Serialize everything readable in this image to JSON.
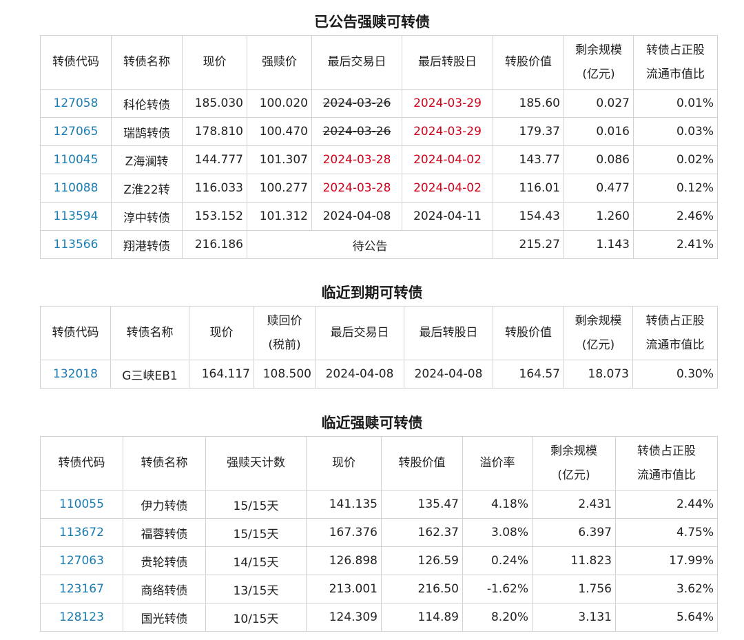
{
  "sections": [
    {
      "title": "已公告强赎可转债",
      "headers": [
        "转债代码",
        "转债名称",
        "现价",
        "强赎价",
        "最后交易日",
        "最后转股日",
        "转股价值",
        "剩余规模\n(亿元)",
        "转债占正股\n流通市值比"
      ],
      "rows": [
        [
          "127058",
          "科伦转债",
          "185.030",
          "100.020",
          "2024-03-26",
          "2024-03-29",
          "185.60",
          "0.027",
          "0.01%"
        ],
        [
          "127065",
          "瑞鹄转债",
          "178.810",
          "100.470",
          "2024-03-26",
          "2024-03-29",
          "179.37",
          "0.016",
          "0.03%"
        ],
        [
          "110045",
          "Z海澜转",
          "144.777",
          "101.307",
          "2024-03-28",
          "2024-04-02",
          "143.77",
          "0.086",
          "0.02%"
        ],
        [
          "110088",
          "Z淮22转",
          "116.033",
          "100.277",
          "2024-03-28",
          "2024-04-02",
          "116.01",
          "0.477",
          "0.12%"
        ],
        [
          "113594",
          "淳中转债",
          "153.152",
          "101.312",
          "2024-04-08",
          "2024-04-11",
          "154.43",
          "1.260",
          "2.46%"
        ]
      ],
      "pending_row": [
        "113566",
        "翔港转债",
        "216.186",
        "待公告",
        "215.27",
        "1.143",
        "2.41%"
      ]
    },
    {
      "title": "临近到期可转债",
      "headers": [
        "转债代码",
        "转债名称",
        "现价",
        "赎回价\n(税前)",
        "最后交易日",
        "最后转股日",
        "转股价值",
        "剩余规模\n(亿元)",
        "转债占正股\n流通市值比"
      ],
      "rows": [
        [
          "132018",
          "G三峡EB1",
          "164.117",
          "108.500",
          "2024-04-08",
          "2024-04-08",
          "164.57",
          "18.073",
          "0.30%"
        ]
      ]
    },
    {
      "title": "临近强赎可转债",
      "headers": [
        "转债代码",
        "转债名称",
        "强赎天计数",
        "现价",
        "转股价值",
        "溢价率",
        "剩余规模\n(亿元)",
        "转债占正股\n流通市值比"
      ],
      "rows": [
        [
          "110055",
          "伊力转债",
          "15/15天",
          "141.135",
          "135.47",
          "4.18%",
          "2.431",
          "2.44%"
        ],
        [
          "113672",
          "福蓉转债",
          "15/15天",
          "167.376",
          "162.37",
          "3.08%",
          "6.397",
          "4.75%"
        ],
        [
          "127063",
          "贵轮转债",
          "14/15天",
          "126.898",
          "126.59",
          "0.24%",
          "11.823",
          "17.99%"
        ],
        [
          "123167",
          "商络转债",
          "13/15天",
          "213.001",
          "216.50",
          "-1.62%",
          "1.756",
          "3.62%"
        ],
        [
          "128123",
          "国光转债",
          "10/15天",
          "124.309",
          "114.89",
          "8.20%",
          "3.131",
          "5.64%"
        ]
      ]
    }
  ],
  "colors": {
    "link": "#1a7db3",
    "highlight": "#d0021b",
    "border": "#d2d2d2"
  }
}
